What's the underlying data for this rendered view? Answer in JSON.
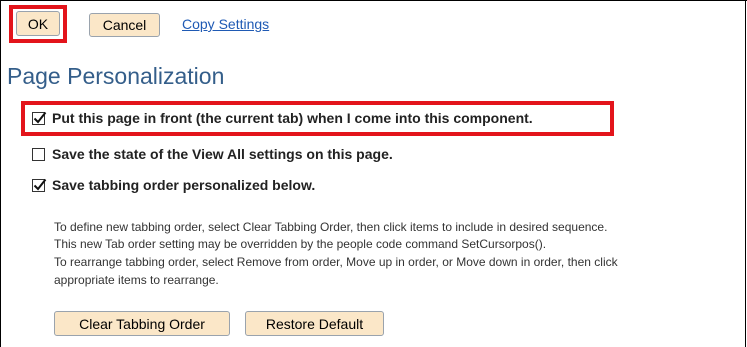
{
  "toolbar": {
    "ok_label": "OK",
    "cancel_label": "Cancel",
    "copy_settings_label": "Copy Settings"
  },
  "page": {
    "title": "Page Personalization"
  },
  "options": [
    {
      "label": "Put this page in front (the current tab) when I come into this component.",
      "checked": true
    },
    {
      "label": "Save the state of the View All settings on this page.",
      "checked": false
    },
    {
      "label": "Save tabbing order personalized below.",
      "checked": true
    }
  ],
  "instructions": [
    "To define new tabbing order, select Clear Tabbing Order, then click items to include in desired sequence.",
    "This new Tab order setting may be overridden by the people code command SetCursorpos().",
    "To rearrange tabbing order, select Remove from order, Move up in order, or Move down in order, then click",
    "appropriate items to rearrange."
  ],
  "actions": {
    "clear_label": "Clear Tabbing Order",
    "restore_label": "Restore Default"
  },
  "colors": {
    "highlight": "#e3141b",
    "button_bg": "#fbe7c8",
    "title": "#345e8a",
    "link": "#1f5ab4"
  }
}
